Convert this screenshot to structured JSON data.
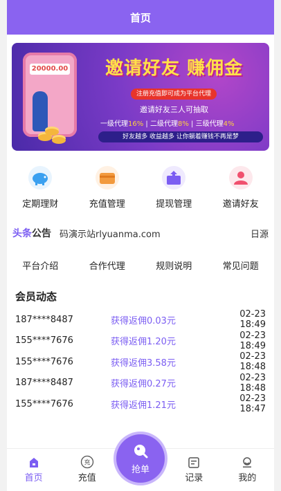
{
  "header": {
    "title": "首页"
  },
  "banner": {
    "screen_amount": "20000.00",
    "headline": "邀请好友 赚佣金",
    "tag": "注册充值即可成为平台代理",
    "line2": "邀请好友三人可抽取",
    "tier1_label": "一级代理",
    "tier1_pct": "16%",
    "tier2_label": "二级代理",
    "tier2_pct": "8%",
    "tier3_label": "三级代理",
    "tier3_pct": "4%",
    "slogan": "好友越多 收益越多 让你躺着赚钱不再是梦"
  },
  "quick_actions": [
    {
      "label": "定期理财",
      "icon": "piggy-bank-icon",
      "color": "#3aa0f0"
    },
    {
      "label": "充值管理",
      "icon": "wallet-icon",
      "color": "#f29a3e"
    },
    {
      "label": "提现管理",
      "icon": "withdraw-icon",
      "color": "#7b5df2"
    },
    {
      "label": "邀请好友",
      "icon": "invite-friends-icon",
      "color": "#f0506e"
    }
  ],
  "notice": {
    "brand_a": "头条",
    "brand_b": "公告",
    "text": "码演示站rlyuanma.com",
    "text2": "日源"
  },
  "links": [
    "平台介绍",
    "合作代理",
    "规则说明",
    "常见问题"
  ],
  "member_feed": {
    "title": "会员动态",
    "rows": [
      {
        "phone": "187****8487",
        "reward": "获得返佣0.03元",
        "time": "02-23 18:49"
      },
      {
        "phone": "155****7676",
        "reward": "获得返佣1.20元",
        "time": "02-23 18:49"
      },
      {
        "phone": "155****7676",
        "reward": "获得返佣3.58元",
        "time": "02-23 18:48"
      },
      {
        "phone": "187****8487",
        "reward": "获得返佣0.27元",
        "time": "02-23 18:48"
      },
      {
        "phone": "155****7676",
        "reward": "获得返佣1.21元",
        "time": "02-23 18:47"
      }
    ]
  },
  "tabbar": {
    "home": "首页",
    "recharge": "充值",
    "recharge_icon_glyph": "充",
    "grab": "抢单",
    "records": "记录",
    "mine": "我的"
  },
  "colors": {
    "accent": "#8a63f0",
    "reward_text": "#7b5df2"
  }
}
